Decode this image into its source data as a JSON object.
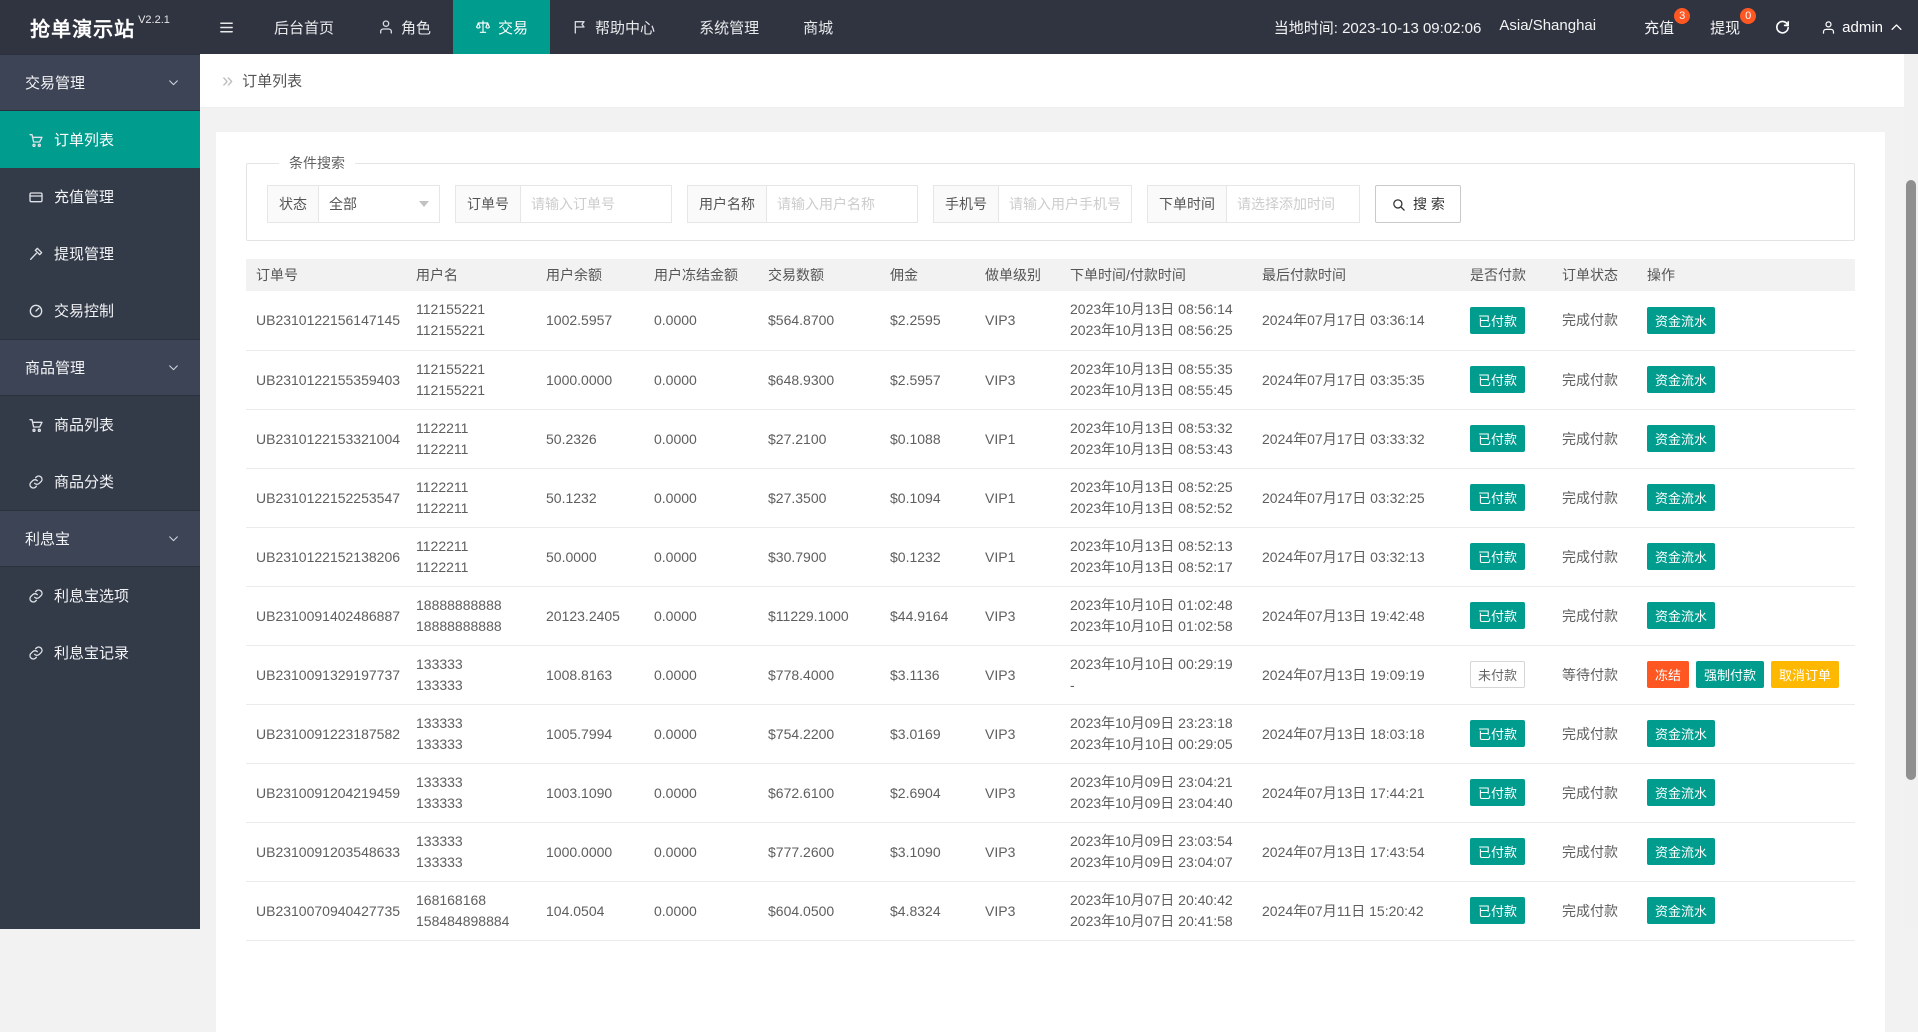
{
  "app": {
    "title": "抢单演示站",
    "version": "V2.2.1"
  },
  "colors": {
    "accent": "#009C8E",
    "red": "#FF5722",
    "yellow": "#FFB800",
    "navbar_bg": "#2F3440",
    "sidebar_bg": "#333A48",
    "sidebar_group_bg": "#3D4455"
  },
  "navbar": {
    "menu_icon": "menu",
    "items": [
      {
        "key": "home",
        "label": "后台首页",
        "icon": null,
        "active": false
      },
      {
        "key": "roles",
        "label": "角色",
        "icon": "user",
        "active": false
      },
      {
        "key": "trade",
        "label": "交易",
        "icon": "scales",
        "active": true
      },
      {
        "key": "help-center",
        "label": "帮助中心",
        "icon": "flag",
        "active": false
      },
      {
        "key": "system",
        "label": "系统管理",
        "icon": null,
        "active": false
      },
      {
        "key": "mall",
        "label": "商城",
        "icon": null,
        "active": false
      }
    ],
    "local_time": "当地时间: 2023-10-13 09:02:06",
    "timezone": "Asia/Shanghai",
    "recharge": {
      "label": "充值",
      "badge": "3"
    },
    "withdraw": {
      "label": "提现",
      "badge": "0"
    },
    "refresh_icon": "refresh",
    "user": {
      "name": "admin",
      "icon": "user",
      "caret_icon": "chevron-up"
    }
  },
  "sidebar": {
    "items": [
      {
        "type": "group",
        "key": "trade-management",
        "label": "交易管理",
        "icon": "chevron-down"
      },
      {
        "type": "item",
        "key": "order-list",
        "label": "订单列表",
        "icon": "cart",
        "active": true
      },
      {
        "type": "item",
        "key": "recharge-management",
        "label": "充值管理",
        "icon": "card",
        "active": false
      },
      {
        "type": "item",
        "key": "withdraw-management",
        "label": "提现管理",
        "icon": "gavel",
        "active": false
      },
      {
        "type": "item",
        "key": "trade-control",
        "label": "交易控制",
        "icon": "gauge",
        "active": false
      },
      {
        "type": "group",
        "key": "goods-management",
        "label": "商品管理",
        "icon": "chevron-down"
      },
      {
        "type": "item",
        "key": "goods-list",
        "label": "商品列表",
        "icon": "cart",
        "active": false
      },
      {
        "type": "item",
        "key": "goods-category",
        "label": "商品分类",
        "icon": "link",
        "active": false
      },
      {
        "type": "group",
        "key": "interest-treasure",
        "label": "利息宝",
        "icon": "chevron-down"
      },
      {
        "type": "item",
        "key": "interest-options",
        "label": "利息宝选项",
        "icon": "link",
        "active": false
      },
      {
        "type": "item",
        "key": "interest-records",
        "label": "利息宝记录",
        "icon": "link",
        "active": false
      }
    ]
  },
  "breadcrumb": {
    "icon": "double-chevron-right",
    "label": "订单列表"
  },
  "search": {
    "legend": "条件搜索",
    "fields": [
      {
        "key": "status",
        "type": "select",
        "label": "状态",
        "value": "全部"
      },
      {
        "key": "order-no",
        "type": "input",
        "label": "订单号",
        "placeholder": "请输入订单号"
      },
      {
        "key": "username",
        "type": "input",
        "label": "用户名称",
        "placeholder": "请输入用户名称"
      },
      {
        "key": "phone",
        "type": "input",
        "label": "手机号",
        "placeholder": "请输入用户手机号"
      },
      {
        "key": "order-time",
        "type": "input",
        "label": "下单时间",
        "placeholder": "请选择添加时间"
      }
    ],
    "button_icon": "search",
    "button_label": "搜 索"
  },
  "table": {
    "headers": [
      "订单号",
      "用户名",
      "用户余额",
      "用户冻结金额",
      "交易数额",
      "佣金",
      "做单级别",
      "下单时间/付款时间",
      "最后付款时间",
      "是否付款",
      "订单状态",
      "操作"
    ],
    "rows": [
      {
        "order_no": "UB2310122156147145",
        "username": [
          "112155221",
          "112155221"
        ],
        "balance": "1002.5957",
        "frozen": "0.0000",
        "amount": "$564.8700",
        "commission": "$2.2595",
        "level": "VIP3",
        "order_time": [
          "2023年10月13日 08:56:14",
          "2023年10月13日 08:56:25"
        ],
        "last_pay_time": "2024年07月17日 03:36:14",
        "paid": {
          "label": "已付款",
          "style": "solid"
        },
        "status": "完成付款",
        "actions": [
          {
            "key": "fund-flow",
            "label": "资金流水",
            "style": "teal"
          }
        ]
      },
      {
        "order_no": "UB2310122155359403",
        "username": [
          "112155221",
          "112155221"
        ],
        "balance": "1000.0000",
        "frozen": "0.0000",
        "amount": "$648.9300",
        "commission": "$2.5957",
        "level": "VIP3",
        "order_time": [
          "2023年10月13日 08:55:35",
          "2023年10月13日 08:55:45"
        ],
        "last_pay_time": "2024年07月17日 03:35:35",
        "paid": {
          "label": "已付款",
          "style": "solid"
        },
        "status": "完成付款",
        "actions": [
          {
            "key": "fund-flow",
            "label": "资金流水",
            "style": "teal"
          }
        ]
      },
      {
        "order_no": "UB2310122153321004",
        "username": [
          "1122211",
          "1122211"
        ],
        "balance": "50.2326",
        "frozen": "0.0000",
        "amount": "$27.2100",
        "commission": "$0.1088",
        "level": "VIP1",
        "order_time": [
          "2023年10月13日 08:53:32",
          "2023年10月13日 08:53:43"
        ],
        "last_pay_time": "2024年07月17日 03:33:32",
        "paid": {
          "label": "已付款",
          "style": "solid"
        },
        "status": "完成付款",
        "actions": [
          {
            "key": "fund-flow",
            "label": "资金流水",
            "style": "teal"
          }
        ]
      },
      {
        "order_no": "UB2310122152253547",
        "username": [
          "1122211",
          "1122211"
        ],
        "balance": "50.1232",
        "frozen": "0.0000",
        "amount": "$27.3500",
        "commission": "$0.1094",
        "level": "VIP1",
        "order_time": [
          "2023年10月13日 08:52:25",
          "2023年10月13日 08:52:52"
        ],
        "last_pay_time": "2024年07月17日 03:32:25",
        "paid": {
          "label": "已付款",
          "style": "solid"
        },
        "status": "完成付款",
        "actions": [
          {
            "key": "fund-flow",
            "label": "资金流水",
            "style": "teal"
          }
        ]
      },
      {
        "order_no": "UB2310122152138206",
        "username": [
          "1122211",
          "1122211"
        ],
        "balance": "50.0000",
        "frozen": "0.0000",
        "amount": "$30.7900",
        "commission": "$0.1232",
        "level": "VIP1",
        "order_time": [
          "2023年10月13日 08:52:13",
          "2023年10月13日 08:52:17"
        ],
        "last_pay_time": "2024年07月17日 03:32:13",
        "paid": {
          "label": "已付款",
          "style": "solid"
        },
        "status": "完成付款",
        "actions": [
          {
            "key": "fund-flow",
            "label": "资金流水",
            "style": "teal"
          }
        ]
      },
      {
        "order_no": "UB2310091402486887",
        "username": [
          "18888888888",
          "18888888888"
        ],
        "balance": "20123.2405",
        "frozen": "0.0000",
        "amount": "$11229.1000",
        "commission": "$44.9164",
        "level": "VIP3",
        "order_time": [
          "2023年10月10日 01:02:48",
          "2023年10月10日 01:02:58"
        ],
        "last_pay_time": "2024年07月13日 19:42:48",
        "paid": {
          "label": "已付款",
          "style": "solid"
        },
        "status": "完成付款",
        "actions": [
          {
            "key": "fund-flow",
            "label": "资金流水",
            "style": "teal"
          }
        ]
      },
      {
        "order_no": "UB2310091329197737",
        "username": [
          "133333",
          "133333"
        ],
        "balance": "1008.8163",
        "frozen": "0.0000",
        "amount": "$778.4000",
        "commission": "$3.1136",
        "level": "VIP3",
        "order_time": [
          "2023年10月10日 00:29:19",
          "-"
        ],
        "last_pay_time": "2024年07月13日 19:09:19",
        "paid": {
          "label": "未付款",
          "style": "plain"
        },
        "status": "等待付款",
        "actions": [
          {
            "key": "freeze",
            "label": "冻结",
            "style": "red"
          },
          {
            "key": "force-pay",
            "label": "强制付款",
            "style": "teal"
          },
          {
            "key": "cancel-order",
            "label": "取消订单",
            "style": "yellow"
          }
        ]
      },
      {
        "order_no": "UB2310091223187582",
        "username": [
          "133333",
          "133333"
        ],
        "balance": "1005.7994",
        "frozen": "0.0000",
        "amount": "$754.2200",
        "commission": "$3.0169",
        "level": "VIP3",
        "order_time": [
          "2023年10月09日 23:23:18",
          "2023年10月10日 00:29:05"
        ],
        "last_pay_time": "2024年07月13日 18:03:18",
        "paid": {
          "label": "已付款",
          "style": "solid"
        },
        "status": "完成付款",
        "actions": [
          {
            "key": "fund-flow",
            "label": "资金流水",
            "style": "teal"
          }
        ]
      },
      {
        "order_no": "UB2310091204219459",
        "username": [
          "133333",
          "133333"
        ],
        "balance": "1003.1090",
        "frozen": "0.0000",
        "amount": "$672.6100",
        "commission": "$2.6904",
        "level": "VIP3",
        "order_time": [
          "2023年10月09日 23:04:21",
          "2023年10月09日 23:04:40"
        ],
        "last_pay_time": "2024年07月13日 17:44:21",
        "paid": {
          "label": "已付款",
          "style": "solid"
        },
        "status": "完成付款",
        "actions": [
          {
            "key": "fund-flow",
            "label": "资金流水",
            "style": "teal"
          }
        ]
      },
      {
        "order_no": "UB2310091203548633",
        "username": [
          "133333",
          "133333"
        ],
        "balance": "1000.0000",
        "frozen": "0.0000",
        "amount": "$777.2600",
        "commission": "$3.1090",
        "level": "VIP3",
        "order_time": [
          "2023年10月09日 23:03:54",
          "2023年10月09日 23:04:07"
        ],
        "last_pay_time": "2024年07月13日 17:43:54",
        "paid": {
          "label": "已付款",
          "style": "solid"
        },
        "status": "完成付款",
        "actions": [
          {
            "key": "fund-flow",
            "label": "资金流水",
            "style": "teal"
          }
        ]
      },
      {
        "order_no": "UB2310070940427735",
        "username": [
          "168168168",
          "158484898884"
        ],
        "balance": "104.0504",
        "frozen": "0.0000",
        "amount": "$604.0500",
        "commission": "$4.8324",
        "level": "VIP3",
        "order_time": [
          "2023年10月07日 20:40:42",
          "2023年10月07日 20:41:58"
        ],
        "last_pay_time": "2024年07月11日 15:20:42",
        "paid": {
          "label": "已付款",
          "style": "solid"
        },
        "status": "完成付款",
        "actions": [
          {
            "key": "fund-flow",
            "label": "资金流水",
            "style": "teal"
          }
        ]
      }
    ]
  }
}
